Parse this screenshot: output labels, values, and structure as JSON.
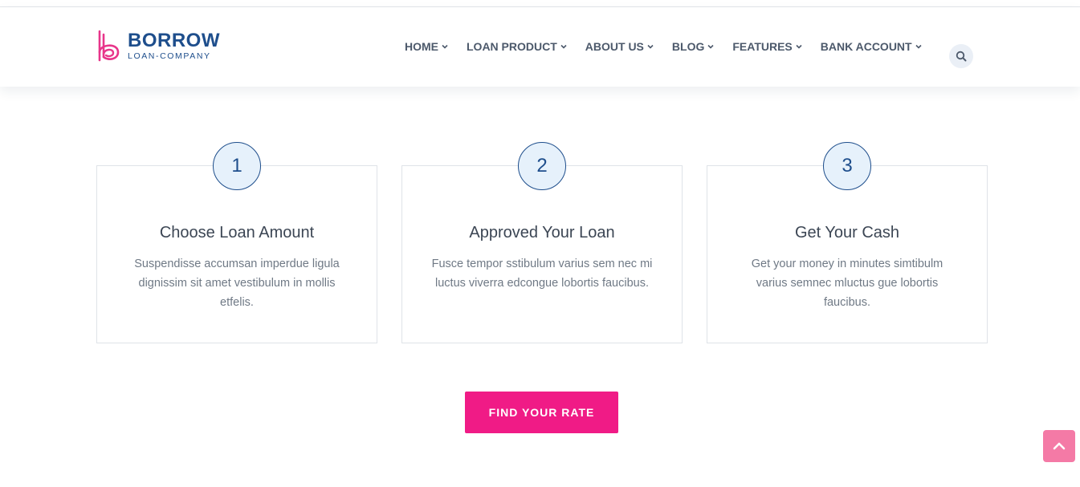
{
  "brand": {
    "name": "BORROW",
    "tagline": "LOAN-COMPANY",
    "colors": {
      "primary": "#1e4e8c",
      "accent": "#f01b86"
    }
  },
  "nav": {
    "items": [
      {
        "label": "HOME"
      },
      {
        "label": "LOAN PRODUCT"
      },
      {
        "label": "ABOUT US"
      },
      {
        "label": "BLOG"
      },
      {
        "label": "FEATURES"
      },
      {
        "label": "BANK ACCOUNT"
      }
    ],
    "search_icon": "search-icon"
  },
  "steps": [
    {
      "number": "1",
      "title": "Choose Loan Amount",
      "description": "Suspendisse accumsan imperdue ligula dignissim sit amet vestibulum in mollis etfelis."
    },
    {
      "number": "2",
      "title": "Approved Your Loan",
      "description": "Fusce tempor sstibulum varius sem nec mi luctus viverra edcongue lobortis faucibus."
    },
    {
      "number": "3",
      "title": "Get Your Cash",
      "description": "Get your money in minutes simtibulm varius semnec mluctus gue lobortis faucibus."
    }
  ],
  "cta": {
    "label": "FIND YOUR RATE"
  },
  "scroll_top_icon": "chevron-up-icon"
}
